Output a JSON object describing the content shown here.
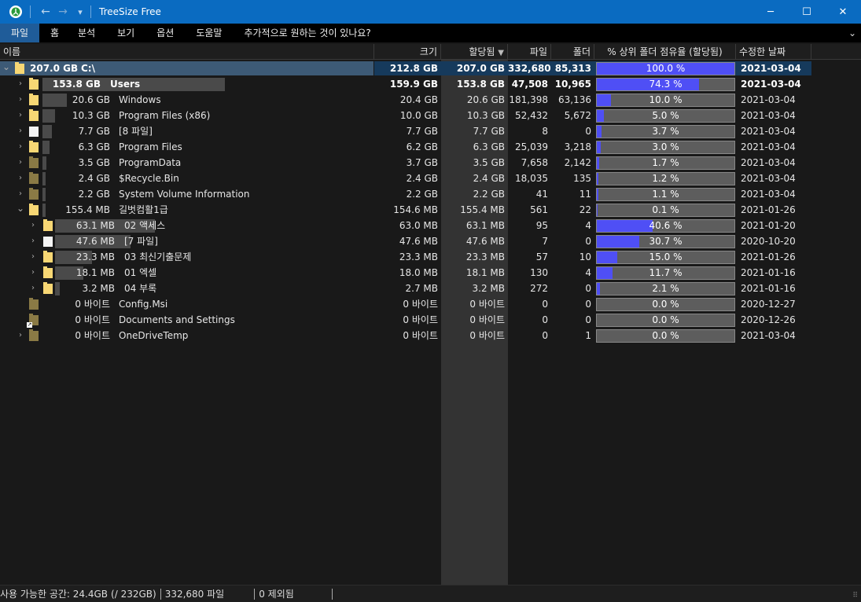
{
  "titlebar": {
    "title": "TreeSize Free",
    "back_icon": "←",
    "forward_icon": "→",
    "dropdown_icon": "▾",
    "minimize": "─",
    "maximize": "☐",
    "close": "✕"
  },
  "menu": {
    "items": [
      "파일",
      "홈",
      "분석",
      "보기",
      "옵션",
      "도움말",
      "추가적으로 원하는 것이 있나요?"
    ],
    "active_index": 0,
    "expand_icon": "⌄"
  },
  "columns": {
    "name": "이름",
    "size": "크기",
    "allocated": "할당됨",
    "sort_icon": "▼",
    "files": "파일",
    "folders": "폴더",
    "percent": "% 상위 폴더 점유율 (할당됨)",
    "modified": "수정한 날짜"
  },
  "rows": [
    {
      "chevron": "⌄",
      "icon": "yellow",
      "name_size": "207.0 GB",
      "name": "C:\\",
      "size": "212.8 GB",
      "allocated": "207.0 GB",
      "files": "332,680",
      "folders": "85,313",
      "percent": 100.0,
      "percent_text": "100.0 %",
      "date": "2021-03-04",
      "bold": true,
      "selected": true
    },
    {
      "chevron": "›",
      "icon": "yellow",
      "name_size": "153.8 GB",
      "name": "Users",
      "size": "159.9 GB",
      "allocated": "153.8 GB",
      "files": "47,508",
      "folders": "10,965",
      "percent": 74.3,
      "percent_text": "74.3 %",
      "date": "2021-03-04",
      "bold": true
    },
    {
      "chevron": "›",
      "icon": "yellow",
      "name_size": "20.6 GB",
      "name": "Windows",
      "size": "20.4 GB",
      "allocated": "20.6 GB",
      "files": "181,398",
      "folders": "63,136",
      "percent": 10.0,
      "percent_text": "10.0 %",
      "date": "2021-03-04"
    },
    {
      "chevron": "›",
      "icon": "yellow",
      "name_size": "10.3 GB",
      "name": "Program Files (x86)",
      "size": "10.0 GB",
      "allocated": "10.3 GB",
      "files": "52,432",
      "folders": "5,672",
      "percent": 5.0,
      "percent_text": "5.0 %",
      "date": "2021-03-04"
    },
    {
      "chevron": "›",
      "icon": "file",
      "name_size": "7.7 GB",
      "name": "[8 파일]",
      "size": "7.7 GB",
      "allocated": "7.7 GB",
      "files": "8",
      "folders": "0",
      "percent": 3.7,
      "percent_text": "3.7 %",
      "date": "2021-03-04"
    },
    {
      "chevron": "›",
      "icon": "yellow",
      "name_size": "6.3 GB",
      "name": "Program Files",
      "size": "6.2 GB",
      "allocated": "6.3 GB",
      "files": "25,039",
      "folders": "3,218",
      "percent": 3.0,
      "percent_text": "3.0 %",
      "date": "2021-03-04"
    },
    {
      "chevron": "›",
      "icon": "dark",
      "name_size": "3.5 GB",
      "name": "ProgramData",
      "size": "3.7 GB",
      "allocated": "3.5 GB",
      "files": "7,658",
      "folders": "2,142",
      "percent": 1.7,
      "percent_text": "1.7 %",
      "date": "2021-03-04"
    },
    {
      "chevron": "›",
      "icon": "dark",
      "name_size": "2.4 GB",
      "name": "$Recycle.Bin",
      "size": "2.4 GB",
      "allocated": "2.4 GB",
      "files": "18,035",
      "folders": "135",
      "percent": 1.2,
      "percent_text": "1.2 %",
      "date": "2021-03-04"
    },
    {
      "chevron": "›",
      "icon": "dark",
      "name_size": "2.2 GB",
      "name": "System Volume Information",
      "size": "2.2 GB",
      "allocated": "2.2 GB",
      "files": "41",
      "folders": "11",
      "percent": 1.1,
      "percent_text": "1.1 %",
      "date": "2021-03-04"
    },
    {
      "chevron": "⌄",
      "icon": "yellow",
      "name_size": "155.4 MB",
      "name": "길벗컴활1급",
      "size": "154.6 MB",
      "allocated": "155.4 MB",
      "files": "561",
      "folders": "22",
      "percent": 0.1,
      "percent_text": "0.1 %",
      "date": "2021-01-26"
    },
    {
      "chevron": "›",
      "icon": "yellow",
      "name_size": "63.1 MB",
      "name": "02 액세스",
      "size": "63.0 MB",
      "allocated": "63.1 MB",
      "files": "95",
      "folders": "4",
      "percent": 40.6,
      "percent_text": "40.6 %",
      "date": "2021-01-20",
      "child": true
    },
    {
      "chevron": "›",
      "icon": "file",
      "name_size": "47.6 MB",
      "name": "[7 파일]",
      "size": "47.6 MB",
      "allocated": "47.6 MB",
      "files": "7",
      "folders": "0",
      "percent": 30.7,
      "percent_text": "30.7 %",
      "date": "2020-10-20",
      "child": true
    },
    {
      "chevron": "›",
      "icon": "yellow",
      "name_size": "23.3 MB",
      "name": "03 최신기출문제",
      "size": "23.3 MB",
      "allocated": "23.3 MB",
      "files": "57",
      "folders": "10",
      "percent": 15.0,
      "percent_text": "15.0 %",
      "date": "2021-01-26",
      "child": true
    },
    {
      "chevron": "›",
      "icon": "yellow",
      "name_size": "18.1 MB",
      "name": "01 엑셀",
      "size": "18.0 MB",
      "allocated": "18.1 MB",
      "files": "130",
      "folders": "4",
      "percent": 11.7,
      "percent_text": "11.7 %",
      "date": "2021-01-16",
      "child": true
    },
    {
      "chevron": "›",
      "icon": "yellow",
      "name_size": "3.2 MB",
      "name": "04 부록",
      "size": "2.7 MB",
      "allocated": "3.2 MB",
      "files": "272",
      "folders": "0",
      "percent": 2.1,
      "percent_text": "2.1 %",
      "date": "2021-01-16",
      "child": true
    },
    {
      "chevron": "",
      "icon": "dark",
      "name_size": "0 바이트",
      "name": "Config.Msi",
      "size": "0 바이트",
      "allocated": "0 바이트",
      "files": "0",
      "folders": "0",
      "percent": 0.0,
      "percent_text": "0.0 %",
      "date": "2020-12-27"
    },
    {
      "chevron": "",
      "icon": "dark-link",
      "name_size": "0 바이트",
      "name": "Documents and Settings",
      "size": "0 바이트",
      "allocated": "0 바이트",
      "files": "0",
      "folders": "0",
      "percent": 0.0,
      "percent_text": "0.0 %",
      "date": "2020-12-26"
    },
    {
      "chevron": "›",
      "icon": "dark",
      "name_size": "0 바이트",
      "name": "OneDriveTemp",
      "size": "0 바이트",
      "allocated": "0 바이트",
      "files": "0",
      "folders": "1",
      "percent": 0.0,
      "percent_text": "0.0 %",
      "date": "2021-03-04"
    }
  ],
  "status": {
    "free_space": "사용 가능한 공간: 24.4GB",
    "total": "(/ 232GB)",
    "files": "332,680 파일",
    "excluded": "0 제외됨"
  },
  "colors": {
    "titlebar": "#0a6bc1",
    "selected_row": "#163a5c",
    "percent_fill": "#4f4ff5",
    "folder": "#f7d774"
  }
}
